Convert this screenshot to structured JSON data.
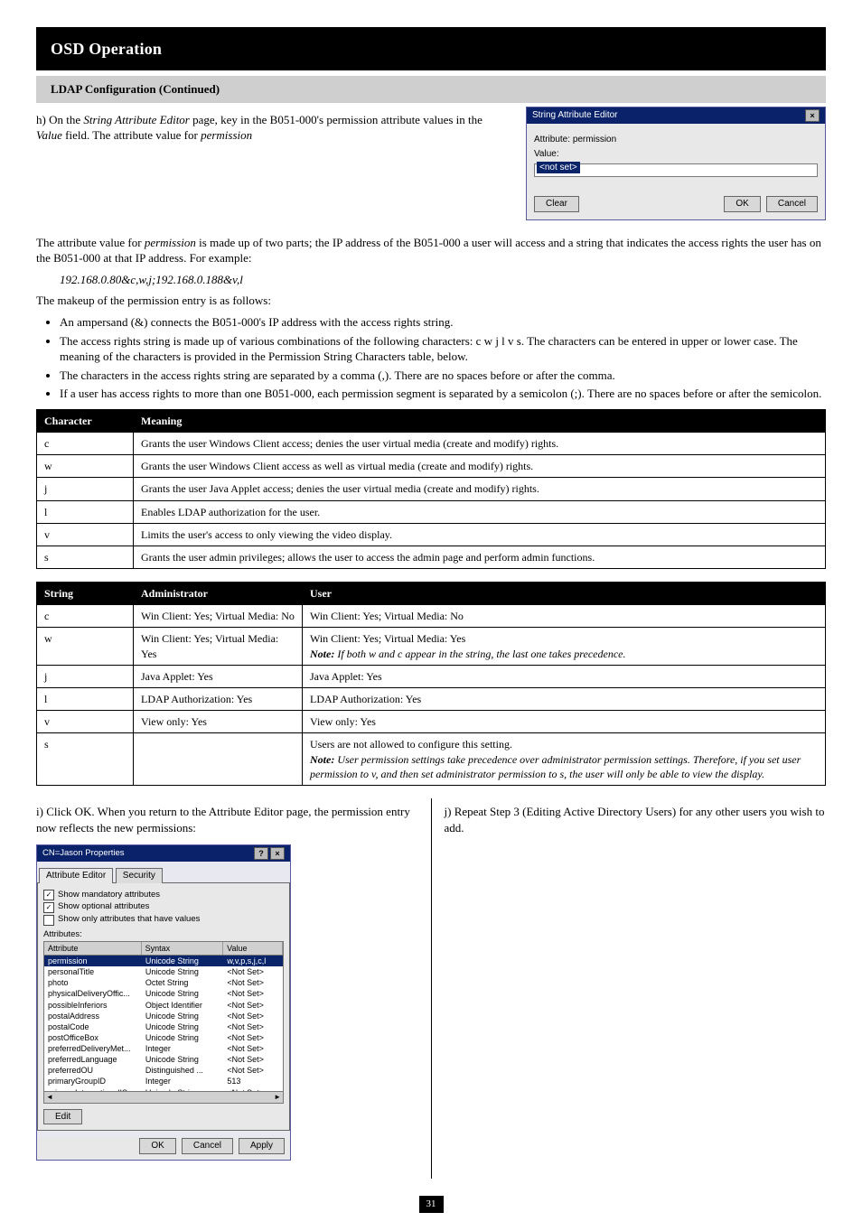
{
  "header": {
    "section": "OSD Operation",
    "subsection": "LDAP Configuration (Continued)"
  },
  "intro": {
    "lead_h": "h)",
    "lead_text": "On the ",
    "lead_em": "String Attribute Editor",
    "lead_tail": " page, key in the B051-000's permission attribute values in the ",
    "lead_em2": "Value",
    "lead_tail2": " field. The attribute value for ",
    "lead_em3": "permission"
  },
  "fig1": {
    "title": "String Attribute Editor",
    "attr_label": "Attribute:",
    "attr_val": "permission",
    "value_label": "Value:",
    "value_sel": "<not set>",
    "clear": "Clear",
    "ok": "OK",
    "cancel": "Cancel"
  },
  "para2_lead": "The attribute value for ",
  "para2_em": "permission",
  "para2_tail": " is made up of two parts; the IP address of the B051-000 a user will access and a string that indicates the access rights the user has on the B051-000 at that IP address. For example:",
  "example1": "192.168.0.80&c,w,j;192.168.0.188&v,l",
  "example1_note": "The makeup of the permission entry is as follows:",
  "bullets": [
    "An ampersand (&) connects the B051-000's IP address with the access rights string.",
    "The access rights string is made up of various combinations of the following characters: c w j l v s. The characters can be entered in upper or lower case. The meaning of the characters is provided in the Permission String Characters table, below.",
    "The characters in the access rights string are separated by a comma (,). There are no spaces before or after the comma.",
    "If a user has access rights to more than one B051-000, each permission segment is separated by a semicolon (;). There are no spaces before or after the semicolon."
  ],
  "t1": {
    "head": [
      "Character",
      "Meaning"
    ],
    "rows": [
      [
        "c",
        "Grants the user Windows Client access; denies the user virtual media (create and modify) rights."
      ],
      [
        "w",
        "Grants the user Windows Client access as well as virtual media (create and modify) rights."
      ],
      [
        "j",
        "Grants the user Java Applet access; denies the user virtual media (create and modify) rights."
      ],
      [
        "l",
        "Enables LDAP authorization for the user."
      ],
      [
        "v",
        "Limits the user's access to only viewing the video display."
      ],
      [
        "s",
        "Grants the user admin privileges; allows the user to access the admin page and perform admin functions."
      ]
    ]
  },
  "t2": {
    "head": [
      "String",
      "Administrator",
      "User"
    ],
    "rows": [
      [
        "c",
        "Win Client: Yes; Virtual Media: No",
        "Win Client: Yes; Virtual Media: No"
      ],
      [
        "w",
        "Win Client: Yes; Virtual Media: Yes",
        "Win Client: Yes; Virtual Media: Yes\nNote: If both w and c appear in the string, the last one takes precedence."
      ],
      [
        "j",
        "Java Applet: Yes",
        "Java Applet: Yes"
      ],
      [
        "l",
        "LDAP Authorization: Yes",
        "LDAP Authorization: Yes"
      ],
      [
        "v",
        "View only: Yes",
        "View only: Yes"
      ],
      [
        "s",
        "",
        "Users are not allowed to configure this setting.\nNote: User permission settings take precedence over administrator permission settings. Therefore, if you set user permission to v, and then set administrator permission to s, the user will only be able to view the display."
      ]
    ]
  },
  "step_i": {
    "letter": "i)",
    "text": "Click OK. When you return to the Attribute Editor page, the permission entry now reflects the new permissions:"
  },
  "step_j": {
    "letter": "j)",
    "text": "Repeat Step 3 (Editing Active Directory Users) for any other users you wish to add."
  },
  "fig2": {
    "title": "CN=Jason Properties",
    "q": "?",
    "x": "×",
    "tab1": "Attribute Editor",
    "tab2": "Security",
    "chk1": "Show mandatory attributes",
    "chk2": "Show optional attributes",
    "chk3": "Show only attributes that have values",
    "attrs_label": "Attributes:",
    "cols": [
      "Attribute",
      "Syntax",
      "Value"
    ],
    "rows": [
      [
        "permission",
        "Unicode String",
        "w,v,p,s,j,c,l"
      ],
      [
        "personalTitle",
        "Unicode String",
        "<Not Set>"
      ],
      [
        "photo",
        "Octet String",
        "<Not Set>"
      ],
      [
        "physicalDeliveryOffic...",
        "Unicode String",
        "<Not Set>"
      ],
      [
        "possibleInferiors",
        "Object Identifier",
        "<Not Set>"
      ],
      [
        "postalAddress",
        "Unicode String",
        "<Not Set>"
      ],
      [
        "postalCode",
        "Unicode String",
        "<Not Set>"
      ],
      [
        "postOfficeBox",
        "Unicode String",
        "<Not Set>"
      ],
      [
        "preferredDeliveryMet...",
        "Integer",
        "<Not Set>"
      ],
      [
        "preferredLanguage",
        "Unicode String",
        "<Not Set>"
      ],
      [
        "preferredOU",
        "Distinguished ...",
        "<Not Set>"
      ],
      [
        "primaryGroupID",
        "Integer",
        "513"
      ],
      [
        "primaryInternationalIS...",
        "Unicode String",
        "<Not Set>"
      ]
    ],
    "edit": "Edit",
    "ok": "OK",
    "cancel": "Cancel",
    "apply": "Apply"
  },
  "page_number": "31"
}
